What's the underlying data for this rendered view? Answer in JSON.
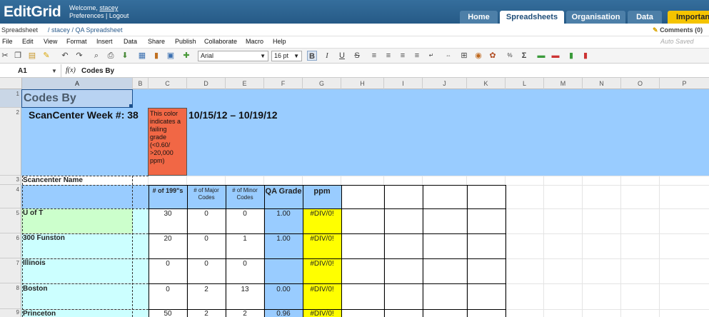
{
  "app": {
    "logo": "EditGrid",
    "welcome_prefix": "Welcome, ",
    "user": "stacey",
    "pref_link": "Preferences",
    "sep": " | ",
    "logout_link": "Logout"
  },
  "nav_tabs": [
    "Home",
    "Spreadsheets",
    "Organisation",
    "Data",
    "Important"
  ],
  "breadcrumb": {
    "label": "Spreadsheet",
    "path": "/ stacey / QA Spreadsheet"
  },
  "comments": "Comments (0)",
  "menus": [
    "File",
    "Edit",
    "View",
    "Format",
    "Insert",
    "Data",
    "Share",
    "Publish",
    "Collaborate",
    "Macro",
    "Help"
  ],
  "autosaved": "Auto Saved",
  "toolbar": {
    "font": "Arial",
    "size": "16 pt"
  },
  "formula": {
    "cell": "A1",
    "fx": "f(x)",
    "value": "Codes By"
  },
  "columns": [
    "A",
    "B",
    "C",
    "D",
    "E",
    "F",
    "G",
    "H",
    "I",
    "J",
    "K",
    "L",
    "M",
    "N",
    "O",
    "P"
  ],
  "rows": [
    "1",
    "2",
    "3",
    "4",
    "5",
    "6",
    "7",
    "8",
    "9"
  ],
  "sheet": {
    "a1": "Codes By",
    "a2": "ScanCenter  Week #: 38",
    "c2_note": "This color indicates a failing grade (<0.60/ >20,000 ppm)",
    "d2_dates": "10/15/12 – 10/19/12",
    "a3": "Scancenter Name",
    "headers": [
      "# of 199\"s",
      "# of Major Codes",
      "# of Minor Codes",
      "QA Grade",
      "ppm"
    ],
    "data_rows": [
      {
        "name": "U of T",
        "c": "30",
        "d": "0",
        "e": "0",
        "f": "1.00",
        "g": "#DIV/0!"
      },
      {
        "name": "300 Funston",
        "c": "20",
        "d": "0",
        "e": "1",
        "f": "1.00",
        "g": "#DIV/0!"
      },
      {
        "name": "Illinois",
        "c": "0",
        "d": "0",
        "e": "0",
        "f": "",
        "g": "#DIV/0!"
      },
      {
        "name": "Boston",
        "c": "0",
        "d": "2",
        "e": "13",
        "f": "0.00",
        "g": "#DIV/0!"
      },
      {
        "name": "Princeton",
        "c": "50",
        "d": "2",
        "e": "2",
        "f": "0.96",
        "g": "#DIV/0!"
      }
    ]
  },
  "colors": {
    "header_blue": "#99ccff",
    "fail_orange": "#f16745",
    "ppm_yellow": "#ffff00",
    "green": "#ccffcc",
    "cyan": "#ccffff"
  }
}
